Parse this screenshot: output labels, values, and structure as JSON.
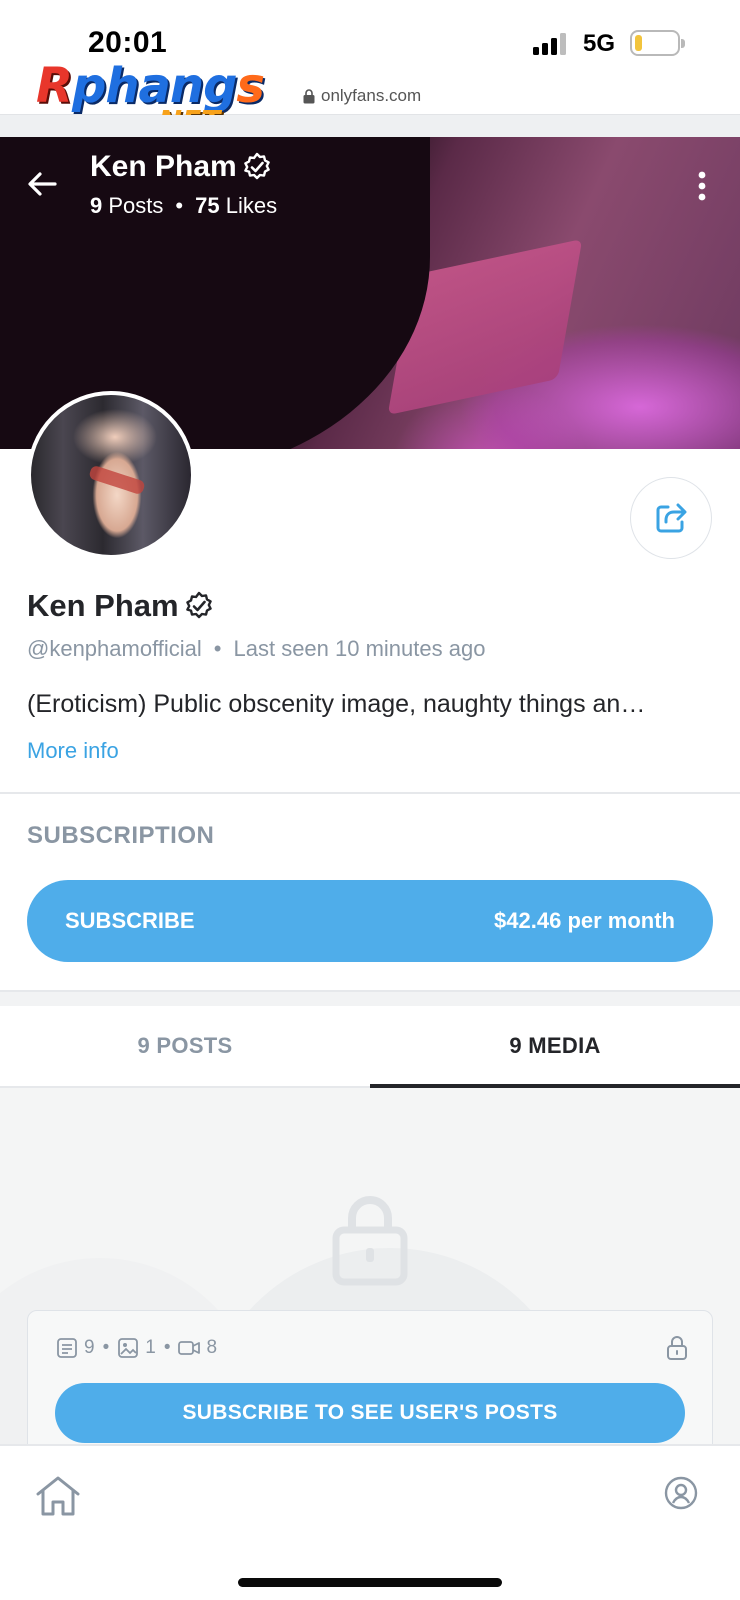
{
  "status_bar": {
    "time": "20:01",
    "network": "5G",
    "battery_level": 0.15
  },
  "overlay_logo": {
    "word": "Rphangs",
    "first_letter": "R",
    "middle": "phang",
    "last_letter": "s",
    "suffix": ".NET"
  },
  "browser": {
    "url": "onlyfans.com"
  },
  "header": {
    "name": "Ken Pham",
    "posts_count": "9",
    "posts_label": "Posts",
    "likes_count": "75",
    "likes_label": "Likes",
    "separator": "•"
  },
  "profile": {
    "name": "Ken Pham",
    "handle": "@kenphamofficial",
    "separator": "•",
    "last_seen": "Last seen 10 minutes ago",
    "bio": "(Eroticism) Public obscenity image, naughty things an…",
    "more_info": "More info"
  },
  "subscription": {
    "title": "SUBSCRIPTION",
    "button_label": "SUBSCRIBE",
    "price": "$42.46 per month"
  },
  "tabs": [
    {
      "label": "9 POSTS",
      "active": false
    },
    {
      "label": "9 MEDIA",
      "active": true
    }
  ],
  "locked_card": {
    "posts_count": "9",
    "images_count": "1",
    "videos_count": "8",
    "dot": "•",
    "button_label": "SUBSCRIBE TO SEE USER'S POSTS"
  },
  "colors": {
    "accent": "#4fadea",
    "text_muted": "#8a96a3",
    "text_primary": "#242529"
  },
  "icons": {
    "back": "arrow-left-icon",
    "more": "kebab-icon",
    "verified": "verified-badge-icon",
    "share": "share-icon",
    "lock": "lock-icon",
    "home": "home-icon",
    "profile": "profile-icon"
  }
}
